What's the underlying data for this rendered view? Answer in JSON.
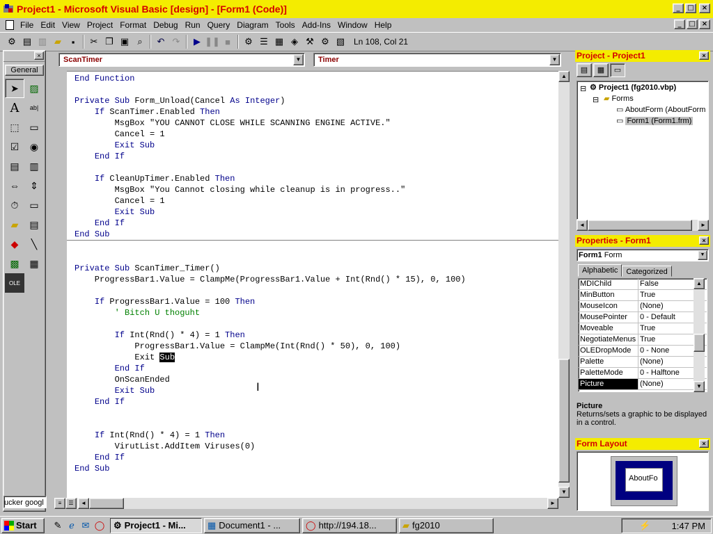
{
  "window": {
    "title": "Project1 - Microsoft Visual Basic [design] - [Form1 (Code)]",
    "controls": [
      "_",
      "□",
      "×"
    ]
  },
  "menu": [
    "File",
    "Edit",
    "View",
    "Project",
    "Format",
    "Debug",
    "Run",
    "Query",
    "Diagram",
    "Tools",
    "Add-Ins",
    "Window",
    "Help"
  ],
  "toolbar": {
    "position": "Ln 108, Col 21"
  },
  "toolbox": {
    "tab": "General",
    "bottom_text": "ucker googl"
  },
  "code_window": {
    "object_combo": "ScanTimer",
    "procedure_combo": "Timer",
    "block1": [
      "End Function",
      "",
      "Private Sub Form_Unload(Cancel As Integer)",
      "    If ScanTimer.Enabled Then",
      "        MsgBox \"YOU CANNOT CLOSE WHILE SCANNING ENGINE ACTIVE.\"",
      "        Cancel = 1",
      "        Exit Sub",
      "    End If",
      "",
      "    If CleanUpTimer.Enabled Then",
      "        MsgBox \"You Cannot closing while cleanup is in progress..\"",
      "        Cancel = 1",
      "        Exit Sub",
      "    End If",
      "End Sub"
    ],
    "block2a": [
      "",
      "",
      "Private Sub ScanTimer_Timer()",
      "    ProgressBar1.Value = ClampMe(ProgressBar1.Value + Int(Rnd() * 15), 0, 100)",
      "",
      "    If ProgressBar1.Value = 100 Then"
    ],
    "comment_line": "        ' Bitch U thoguht",
    "block2b": [
      "",
      "        If Int(Rnd() * 4) = 1 Then",
      "            ProgressBar1.Value = ClampMe(Int(Rnd() * 50), 0, 100)"
    ],
    "exit_prefix": "            Exit ",
    "exit_selected": "Sub",
    "block2c": [
      "        End If",
      "        OnScanEnded",
      "        Exit Sub",
      "    End If",
      "",
      "",
      "    If Int(Rnd() * 4) = 1 Then",
      "        VirutList.AddItem Viruses(0)",
      "    End If",
      "End Sub"
    ]
  },
  "project": {
    "title": "Project - Project1",
    "tree": {
      "root": "Project1 (fg2010.vbp)",
      "folder": "Forms",
      "items": [
        "AboutForm (AboutForm",
        "Form1 (Form1.frm)"
      ]
    }
  },
  "properties": {
    "title": "Properties - Form1",
    "object_name": "Form1",
    "object_type": "Form",
    "tabs": [
      "Alphabetic",
      "Categorized"
    ],
    "rows": [
      {
        "name": "MDIChild",
        "value": "False"
      },
      {
        "name": "MinButton",
        "value": "True"
      },
      {
        "name": "MouseIcon",
        "value": "(None)"
      },
      {
        "name": "MousePointer",
        "value": "0 - Default"
      },
      {
        "name": "Moveable",
        "value": "True"
      },
      {
        "name": "NegotiateMenus",
        "value": "True"
      },
      {
        "name": "OLEDropMode",
        "value": "0 - None"
      },
      {
        "name": "Palette",
        "value": "(None)"
      },
      {
        "name": "PaletteMode",
        "value": "0 - Halftone"
      },
      {
        "name": "Picture",
        "value": "(None)"
      }
    ],
    "desc_title": "Picture",
    "desc_text": "Returns/sets a graphic to be displayed in a control."
  },
  "form_layout": {
    "title": "Form Layout",
    "form_label": "AboutFo"
  },
  "taskbar": {
    "start": "Start",
    "tasks": [
      "Project1 - Mi...",
      "Document1 - ...",
      "http://194.18...",
      "fg2010"
    ],
    "clock": "1:47 PM"
  }
}
